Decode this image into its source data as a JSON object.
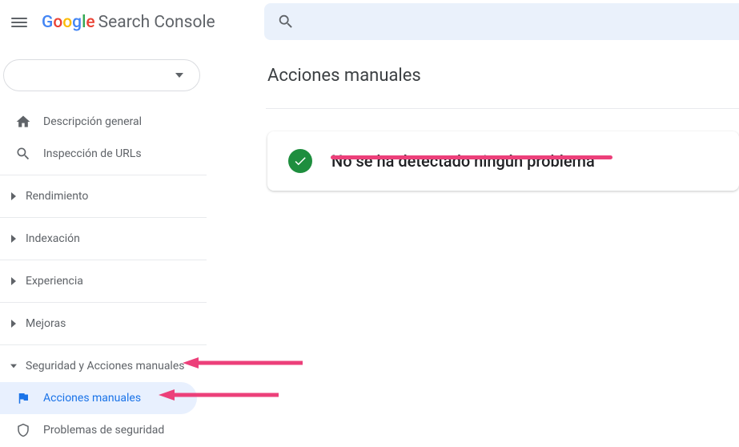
{
  "header": {
    "logo_product": "Search Console"
  },
  "sidebar": {
    "overview": "Descripción general",
    "url_inspection": "Inspección de URLs",
    "sections": {
      "performance": "Rendimiento",
      "indexing": "Indexación",
      "experience": "Experiencia",
      "improvements": "Mejoras",
      "security": "Seguridad y Acciones manuales"
    },
    "subitems": {
      "manual_actions": "Acciones manuales",
      "security_issues": "Problemas de seguridad"
    }
  },
  "main": {
    "title": "Acciones manuales",
    "status_message": "No se ha detectado ningún problema"
  },
  "annotations": {
    "underline_color": "#ec407a",
    "arrow_color": "#ec407a"
  }
}
